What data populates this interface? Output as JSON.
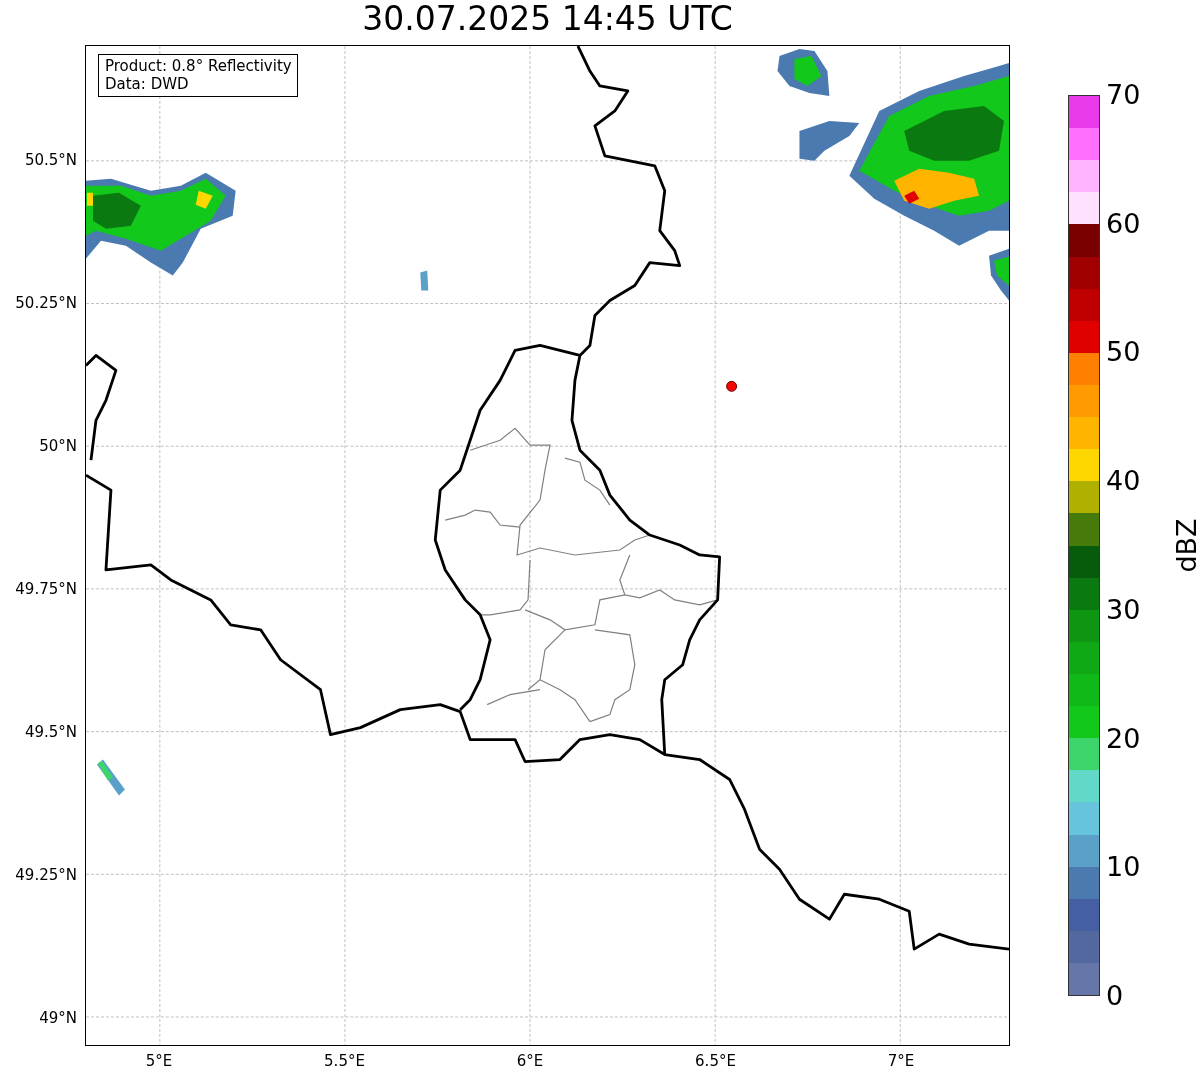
{
  "title": "30.07.2025 14:45 UTC",
  "info_box": [
    "Product: 0.8° Reflectivity",
    "Data: DWD"
  ],
  "y_ticks": [
    "50.5°N",
    "50.25°N",
    "50°N",
    "49.75°N",
    "49.5°N",
    "49.25°N",
    "49°N"
  ],
  "x_ticks": [
    "5°E",
    "5.5°E",
    "6°E",
    "6.5°E",
    "7°E"
  ],
  "colorbar": {
    "label": "dBZ",
    "ticks": [
      "70",
      "60",
      "50",
      "40",
      "30",
      "20",
      "10",
      "0"
    ],
    "bands": [
      {
        "color": "#e93ae9"
      },
      {
        "color": "#ff70ff"
      },
      {
        "color": "#ffb4ff"
      },
      {
        "color": "#ffe0ff"
      },
      {
        "color": "#780000"
      },
      {
        "color": "#a00000"
      },
      {
        "color": "#c00000"
      },
      {
        "color": "#e00000"
      },
      {
        "color": "#ff8000"
      },
      {
        "color": "#ff9a00"
      },
      {
        "color": "#ffb400"
      },
      {
        "color": "#ffd700"
      },
      {
        "color": "#b0b000"
      },
      {
        "color": "#467a0a"
      },
      {
        "color": "#065c0a"
      },
      {
        "color": "#0a7a10"
      },
      {
        "color": "#0e9612"
      },
      {
        "color": "#10a814"
      },
      {
        "color": "#10b818"
      },
      {
        "color": "#12c81a"
      },
      {
        "color": "#3dd56a"
      },
      {
        "color": "#62d8c8"
      },
      {
        "color": "#66c4dc"
      },
      {
        "color": "#5aa0c8"
      },
      {
        "color": "#4a7ab0"
      },
      {
        "color": "#4460a3"
      },
      {
        "color": "#5468a0"
      },
      {
        "color": "#6676a8"
      }
    ]
  }
}
